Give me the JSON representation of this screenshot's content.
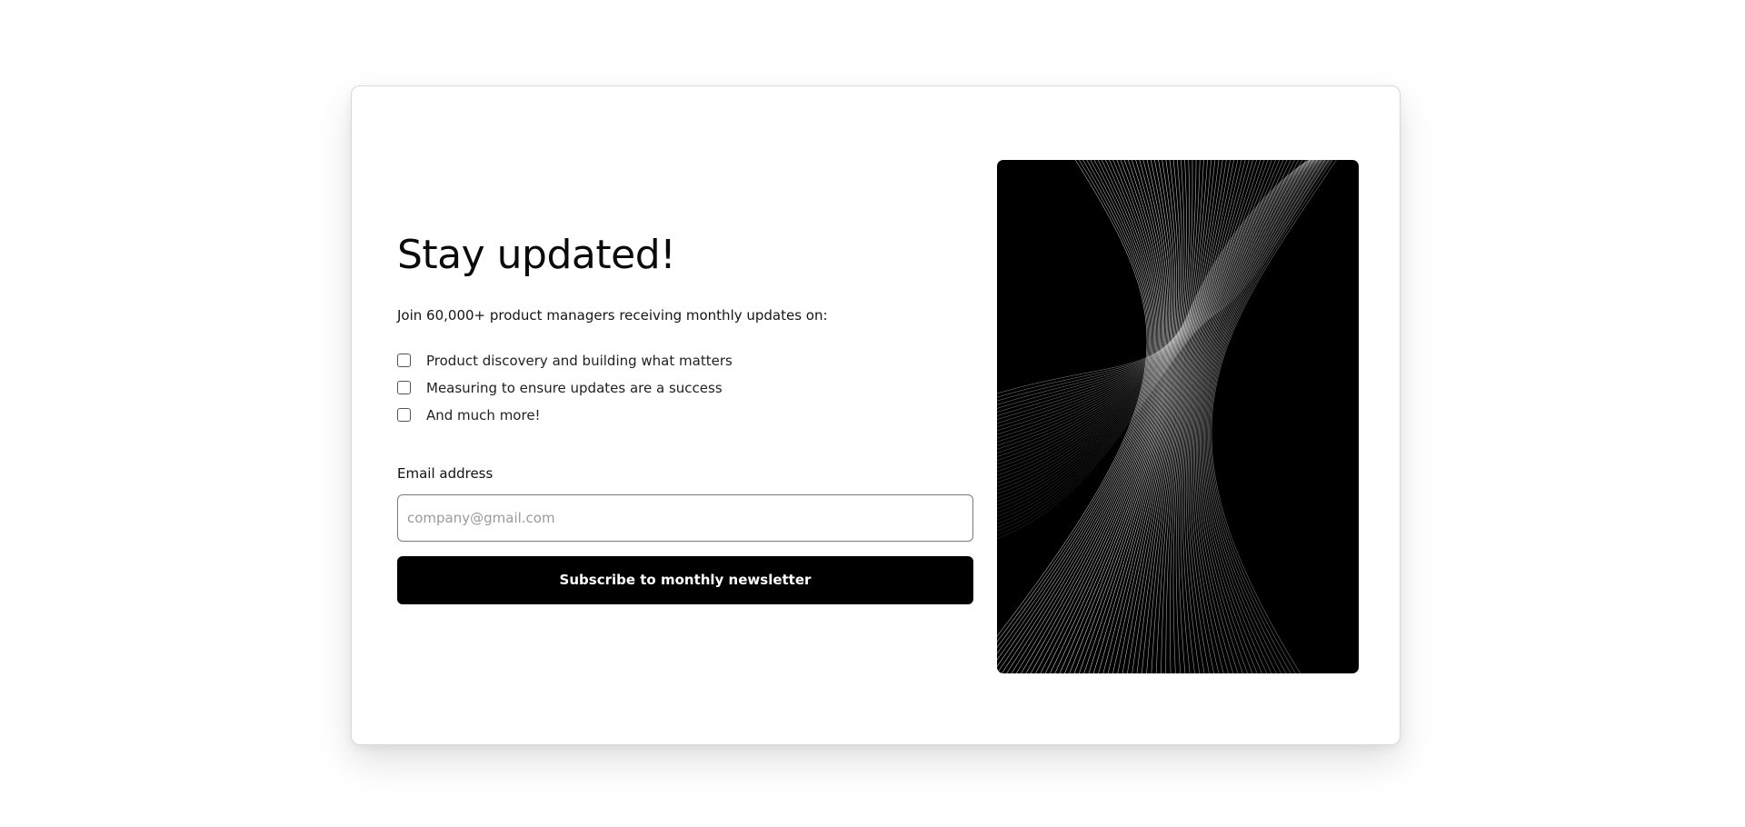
{
  "hero": {
    "title": "Stay updated!",
    "subtitle": "Join 60,000+ product managers receiving monthly updates on:"
  },
  "features": [
    {
      "label": "Product discovery and building what matters",
      "checked": false
    },
    {
      "label": "Measuring to ensure updates are a success",
      "checked": false
    },
    {
      "label": "And much more!",
      "checked": false
    }
  ],
  "form": {
    "email_label": "Email address",
    "email_placeholder": "company@gmail.com",
    "email_value": "",
    "submit_label": "Subscribe to monthly newsletter"
  },
  "colors": {
    "button_bg": "#000000",
    "button_text": "#ffffff",
    "art_bg": "#000000",
    "art_lines": "#ffffff"
  },
  "icons": {
    "feature_checkbox": "checkbox-empty-icon",
    "illustration": "wave-lines-illustration"
  }
}
